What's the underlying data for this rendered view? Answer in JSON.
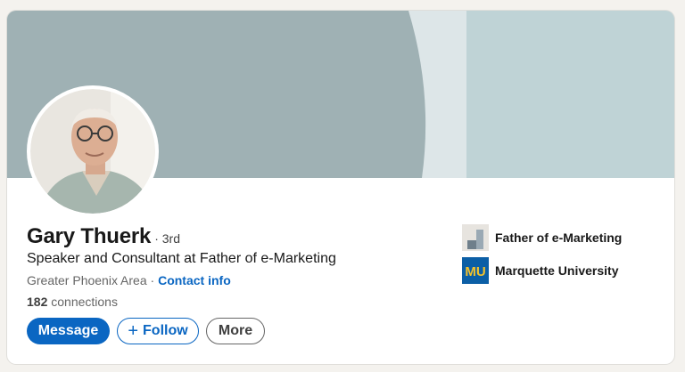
{
  "profile": {
    "name": "Gary Thuerk",
    "degree": "· 3rd",
    "headline": "Speaker and Consultant at Father of e-Marketing",
    "location": "Greater Phoenix Area",
    "separator": "·",
    "contact_label": "Contact info",
    "connections_count": "182",
    "connections_label": "connections"
  },
  "actions": {
    "message": "Message",
    "follow": "Follow",
    "more": "More"
  },
  "experience": [
    {
      "name": "Father of e-Marketing"
    },
    {
      "name": "Marquette University",
      "logo_text": "MU"
    }
  ],
  "colors": {
    "accent": "#0a66c2",
    "banner_dark": "#9fb1b4",
    "banner_light": "#bfd3d6",
    "marquette_blue": "#0c5fa6",
    "marquette_gold": "#f5c32c"
  }
}
